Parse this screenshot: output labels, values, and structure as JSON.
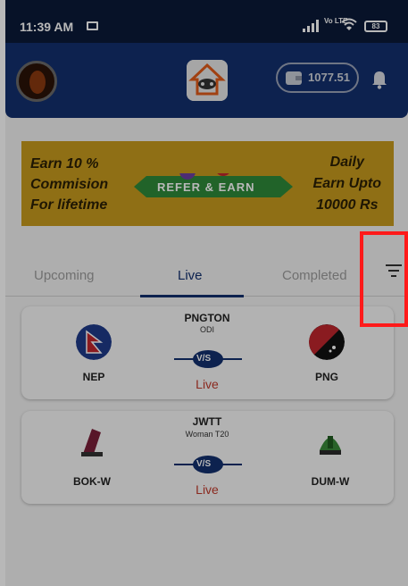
{
  "status_bar": {
    "time": "11:39 AM",
    "network": "Vo LTE",
    "battery": "83"
  },
  "header": {
    "wallet_amount": "1077.51"
  },
  "banner": {
    "left_line1": "Earn 10 %",
    "left_line2": "Commision",
    "left_line3": "For lifetime",
    "center": "REFER & EARN",
    "right_line1": "Daily",
    "right_line2": "Earn Upto",
    "right_line3": "10000 Rs"
  },
  "tabs": {
    "upcoming": "Upcoming",
    "live": "Live",
    "completed": "Completed"
  },
  "matches": [
    {
      "series": "PNGTON",
      "format": "ODI",
      "team1": "NEP",
      "team2": "PNG",
      "vs": "V/S",
      "status": "Live"
    },
    {
      "series": "JWTT",
      "format": "Woman T20",
      "team1": "BOK-W",
      "team2": "DUM-W",
      "vs": "V/S",
      "status": "Live"
    }
  ],
  "colors": {
    "header": "#13306e",
    "accent": "#13306e",
    "live_status": "#c0392b",
    "highlight": "#e31212"
  }
}
